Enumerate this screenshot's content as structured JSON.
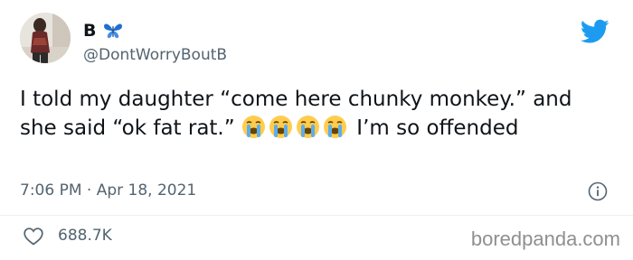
{
  "author": {
    "display_name": "B",
    "handle": "@DontWorryBoutB",
    "avatar_icon": "profile-photo",
    "badge_icon": "butterfly-emoji",
    "badge_color": "#1f6fd1"
  },
  "tweet": {
    "text_part1": "I told my daughter “come here chunky monkey.” and she said “ok fat rat.” ",
    "emoji": [
      "loudly-crying-face",
      "loudly-crying-face",
      "loudly-crying-face",
      "loudly-crying-face"
    ],
    "text_part2": " I’m so offended"
  },
  "meta": {
    "timestamp": "7:06 PM · Apr 18, 2021"
  },
  "engagement": {
    "likes": "688.7K"
  },
  "icons": {
    "brand": "twitter-bird",
    "info": "info-icon",
    "like": "heart-icon"
  },
  "colors": {
    "twitter_blue": "#1d9bf0",
    "secondary_text": "#536471",
    "primary_text": "#0f1419",
    "watermark": "#8f8f8f"
  },
  "watermark": "boredpanda.com"
}
